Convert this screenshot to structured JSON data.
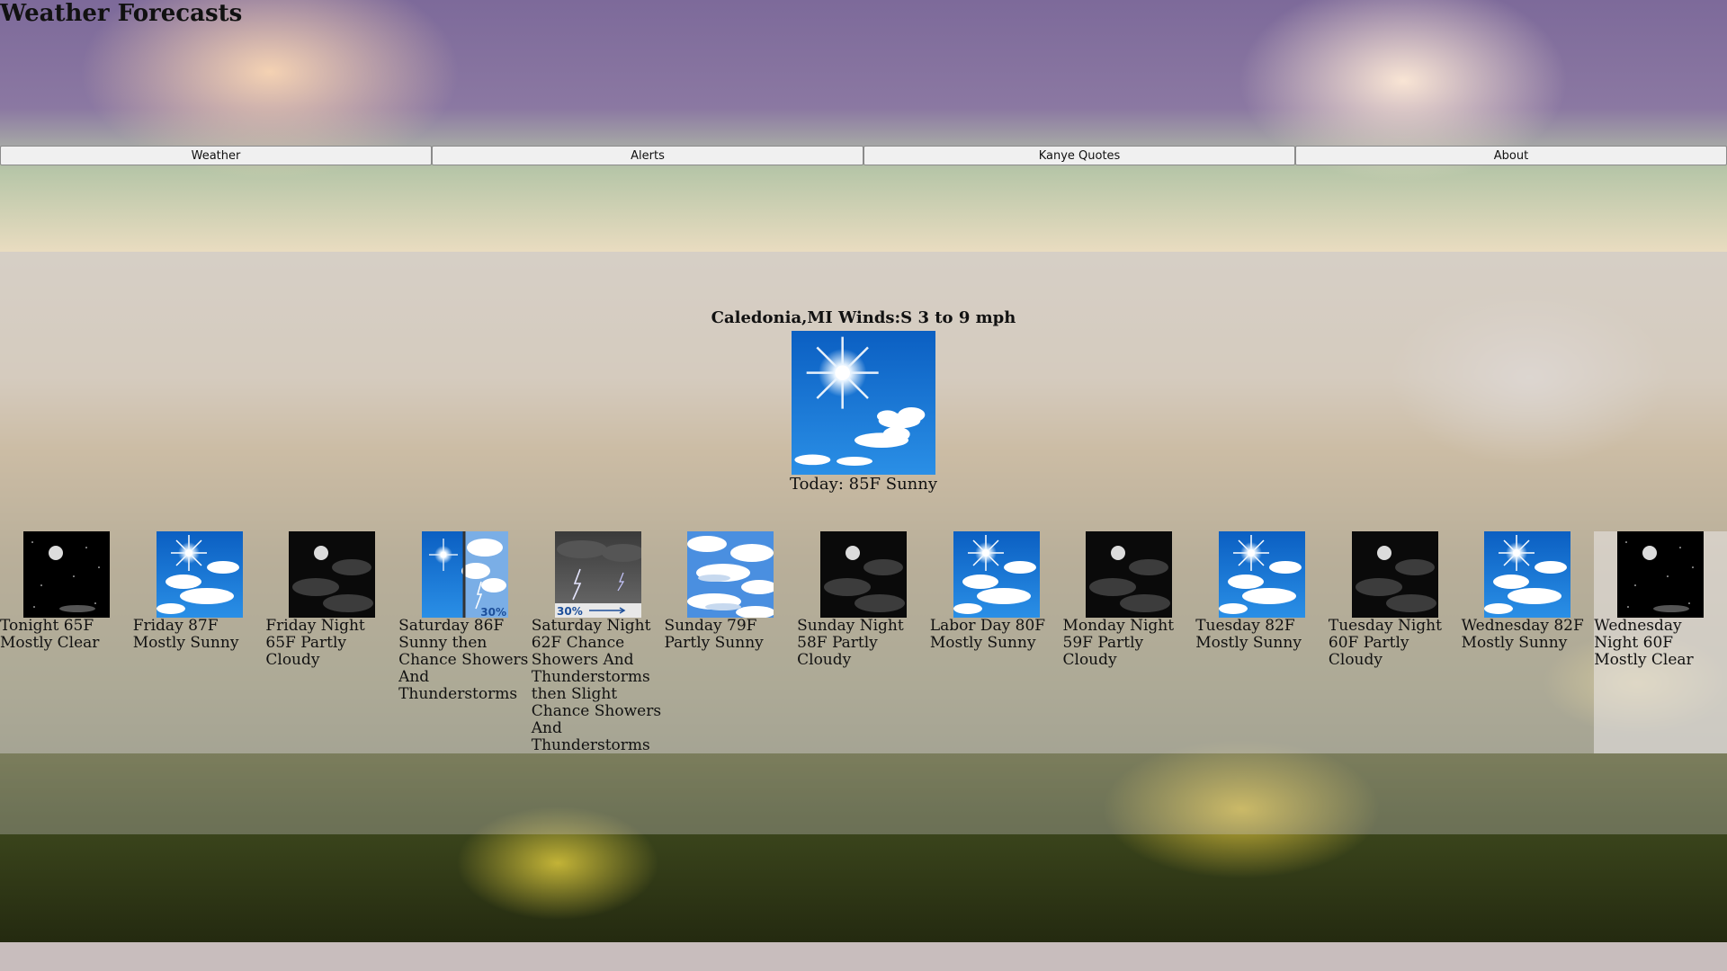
{
  "page": {
    "title": "Weather Forecasts"
  },
  "nav": {
    "items": [
      {
        "label": "Weather"
      },
      {
        "label": "Alerts"
      },
      {
        "label": "Kanye Quotes"
      },
      {
        "label": "About"
      }
    ]
  },
  "current": {
    "location": "Caledonia,MI Winds:S 3 to 9 mph",
    "summary": "Today: 85F Sunny",
    "icon": "sunny-icon"
  },
  "forecast": [
    {
      "text": "Tonight 65F Mostly Clear",
      "icon": "night-clear-icon"
    },
    {
      "text": "Friday 87F Mostly Sunny",
      "icon": "mostly-sunny-icon"
    },
    {
      "text": "Friday Night 65F Partly Cloudy",
      "icon": "night-partly-cloudy-icon"
    },
    {
      "text": "Saturday 86F Sunny then Chance Showers And Thunderstorms",
      "icon": "sunny-then-storm-icon",
      "precip": "30%"
    },
    {
      "text": "Saturday Night 62F Chance Showers And Thunderstorms then Slight Chance Showers And Thunderstorms",
      "icon": "thunderstorm-icon",
      "precip": "30%"
    },
    {
      "text": "Sunday 79F Partly Sunny",
      "icon": "partly-sunny-icon"
    },
    {
      "text": "Sunday Night 58F Partly Cloudy",
      "icon": "night-partly-cloudy-icon"
    },
    {
      "text": "Labor Day 80F Mostly Sunny",
      "icon": "mostly-sunny-icon"
    },
    {
      "text": "Monday Night 59F Partly Cloudy",
      "icon": "night-partly-cloudy-icon"
    },
    {
      "text": "Tuesday 82F Mostly Sunny",
      "icon": "mostly-sunny-icon"
    },
    {
      "text": "Tuesday Night 60F Partly Cloudy",
      "icon": "night-partly-cloudy-icon"
    },
    {
      "text": "Wednesday 82F Mostly Sunny",
      "icon": "mostly-sunny-icon"
    },
    {
      "text": "Wednesday Night 60F Mostly Clear",
      "icon": "night-clear-icon"
    }
  ]
}
